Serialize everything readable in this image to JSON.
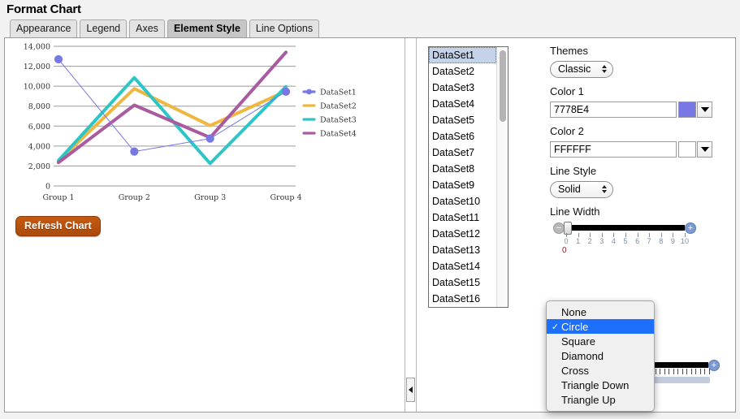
{
  "header": {
    "title": "Format Chart"
  },
  "tabs": [
    {
      "label": "Appearance",
      "active": false
    },
    {
      "label": "Legend",
      "active": false
    },
    {
      "label": "Axes",
      "active": false
    },
    {
      "label": "Element Style",
      "active": true
    },
    {
      "label": "Line Options",
      "active": false
    }
  ],
  "chart_data": {
    "type": "line",
    "title": "",
    "xlabel": "",
    "ylabel": "",
    "categories": [
      "Group 1",
      "Group 2",
      "Group 3",
      "Group 4"
    ],
    "ylim": [
      0,
      14000
    ],
    "ytick_labels": [
      "0",
      "2,000",
      "4,000",
      "6,000",
      "8,000",
      "10,000",
      "12,000",
      "14,000"
    ],
    "yticks": [
      0,
      2000,
      4000,
      6000,
      8000,
      10000,
      12000,
      14000
    ],
    "grid": true,
    "legend_position": "right",
    "series": [
      {
        "name": "DataSet1",
        "color": "#7778E4",
        "values": [
          12700,
          3450,
          4750,
          9450
        ],
        "markers": "circle",
        "line_width": 1
      },
      {
        "name": "DataSet2",
        "color": "#EFB73F",
        "values": [
          2500,
          9750,
          6050,
          9500
        ],
        "markers": "none",
        "line_width": 4
      },
      {
        "name": "DataSet3",
        "color": "#2CC6C6",
        "values": [
          2550,
          10850,
          2250,
          9950
        ],
        "markers": "none",
        "line_width": 4
      },
      {
        "name": "DataSet4",
        "color": "#A95BA0",
        "values": [
          2350,
          8100,
          4850,
          13400
        ],
        "markers": "none",
        "line_width": 4
      }
    ]
  },
  "chart_pane": {
    "refresh_button_label": "Refresh Chart"
  },
  "splitter": {
    "collapse_icon": "triangle-left-icon"
  },
  "dataset_list": {
    "items": [
      "DataSet1",
      "DataSet2",
      "DataSet3",
      "DataSet4",
      "DataSet5",
      "DataSet6",
      "DataSet7",
      "DataSet8",
      "DataSet9",
      "DataSet10",
      "DataSet11",
      "DataSet12",
      "DataSet13",
      "DataSet14",
      "DataSet15",
      "DataSet16"
    ],
    "selected": "DataSet1"
  },
  "controls": {
    "themes": {
      "label": "Themes",
      "value": "Classic"
    },
    "color1": {
      "label": "Color 1",
      "value": "7778E4",
      "swatch": "#7778E4"
    },
    "color2": {
      "label": "Color 2",
      "value": "FFFFFF",
      "swatch": "#FFFFFF"
    },
    "line_style": {
      "label": "Line Style",
      "value": "Solid"
    },
    "line_width": {
      "label": "Line Width",
      "value": "0",
      "min": 0,
      "max": 10,
      "ticks": [
        "0",
        "1",
        "2",
        "3",
        "4",
        "5",
        "6",
        "7",
        "8",
        "9",
        "10"
      ],
      "minus_icon": "minus-circle-icon",
      "plus_icon": "plus-circle-icon"
    }
  },
  "marker_shape_menu": {
    "items": [
      {
        "label": "None",
        "checked": false
      },
      {
        "label": "Circle",
        "checked": true
      },
      {
        "label": "Square",
        "checked": false
      },
      {
        "label": "Diamond",
        "checked": false
      },
      {
        "label": "Cross",
        "checked": false
      },
      {
        "label": "Triangle Down",
        "checked": false
      },
      {
        "label": "Triangle Up",
        "checked": false
      }
    ],
    "check_glyph": "✓"
  }
}
